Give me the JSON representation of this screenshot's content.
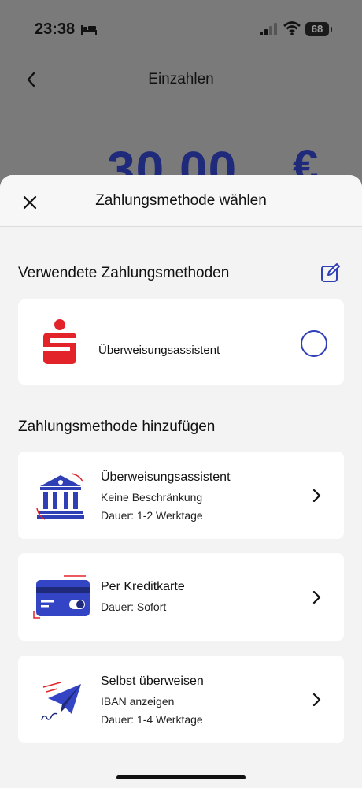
{
  "status_bar": {
    "time": "23:38",
    "battery": "68"
  },
  "background": {
    "title": "Einzahlen",
    "amount": "30,00",
    "currency": "€"
  },
  "sheet": {
    "title": "Zahlungsmethode wählen",
    "used_section": {
      "title": "Verwendete Zahlungsmethoden",
      "items": [
        {
          "label": "Überweisungsassistent",
          "icon": "sparkasse-logo-icon",
          "selected": false
        }
      ]
    },
    "add_section": {
      "title": "Zahlungsmethode hinzufügen",
      "items": [
        {
          "title": "Überweisungsassistent",
          "line1": "Keine Beschränkung",
          "line2": "Dauer: 1-2 Werktage",
          "icon": "bank-icon"
        },
        {
          "title": "Per Kreditkarte",
          "line1": "Dauer: Sofort",
          "icon": "credit-card-icon"
        },
        {
          "title": "Selbst überweisen",
          "line1": "IBAN anzeigen",
          "line2": "Dauer: 1-4 Werktage",
          "icon": "paper-plane-icon"
        }
      ]
    }
  },
  "colors": {
    "accent": "#2f3fb6",
    "brand_red": "#e3232a",
    "sheet_bg": "#f3f3f3"
  }
}
